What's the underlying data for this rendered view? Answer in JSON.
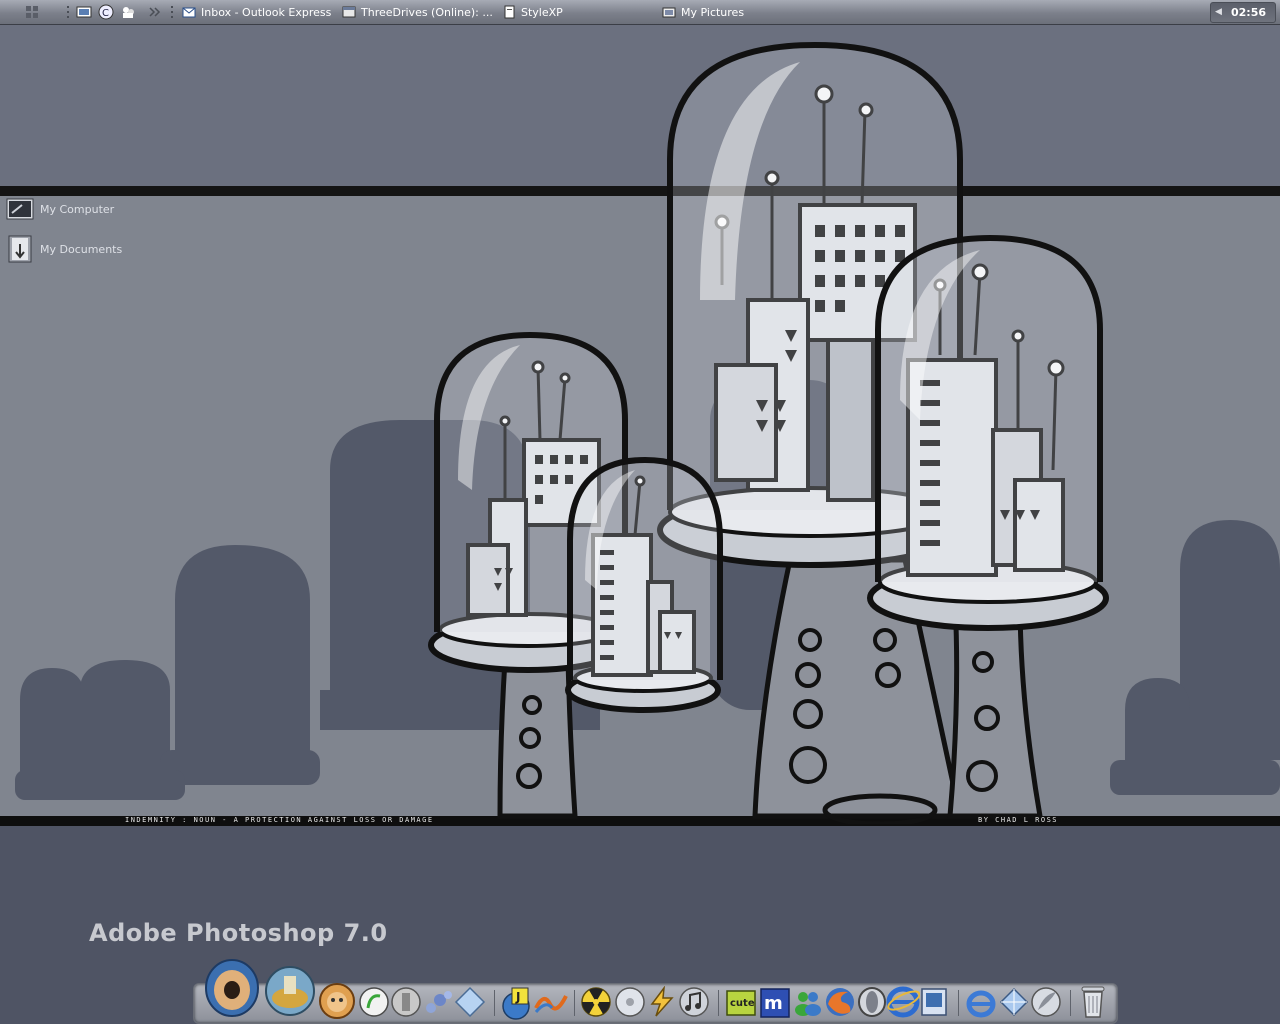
{
  "taskbar": {
    "tasks": [
      {
        "label": "Inbox - Outlook Express",
        "icon": "outlook-express-icon"
      },
      {
        "label": "ThreeDrives (Online): ...",
        "icon": "window-icon"
      },
      {
        "label": "StyleXP",
        "icon": "document-icon"
      },
      {
        "label": "My Pictures",
        "icon": "folder-icon"
      }
    ],
    "clock": "02:56"
  },
  "desktop": {
    "icons": [
      {
        "label": "My Computer",
        "icon": "my-computer-icon"
      },
      {
        "label": "My Documents",
        "icon": "my-documents-icon"
      }
    ]
  },
  "wallpaper": {
    "caption_left": "INDEMNITY : NOUN - A PROTECTION AGAINST LOSS OR DAMAGE",
    "caption_right": "BY CHAD L ROSS"
  },
  "dock": {
    "active_app_label": "Adobe Photoshop 7.0",
    "items": [
      "photoshop-eye-icon",
      "globe-app-icon",
      "face-app-icon",
      "dreamweaver-icon",
      "column-icon",
      "bubbles-icon",
      "crystal-icon",
      "j-globe-icon",
      "wave-icon",
      "nuclear-icon",
      "disc-icon",
      "lightning-icon",
      "music-icon",
      "cuteftp-icon",
      "msn-m-icon",
      "messenger-icon",
      "firefox-icon",
      "opera-icon",
      "ie-icon",
      "preview-icon",
      "ie-alt-icon",
      "diamond-icon",
      "feather-icon",
      "trash-icon"
    ]
  },
  "colors": {
    "band_top": "#6b707f",
    "band_mid": "#80858f",
    "band_bottom": "#4f5464",
    "taskbar": "#8a8e98"
  }
}
